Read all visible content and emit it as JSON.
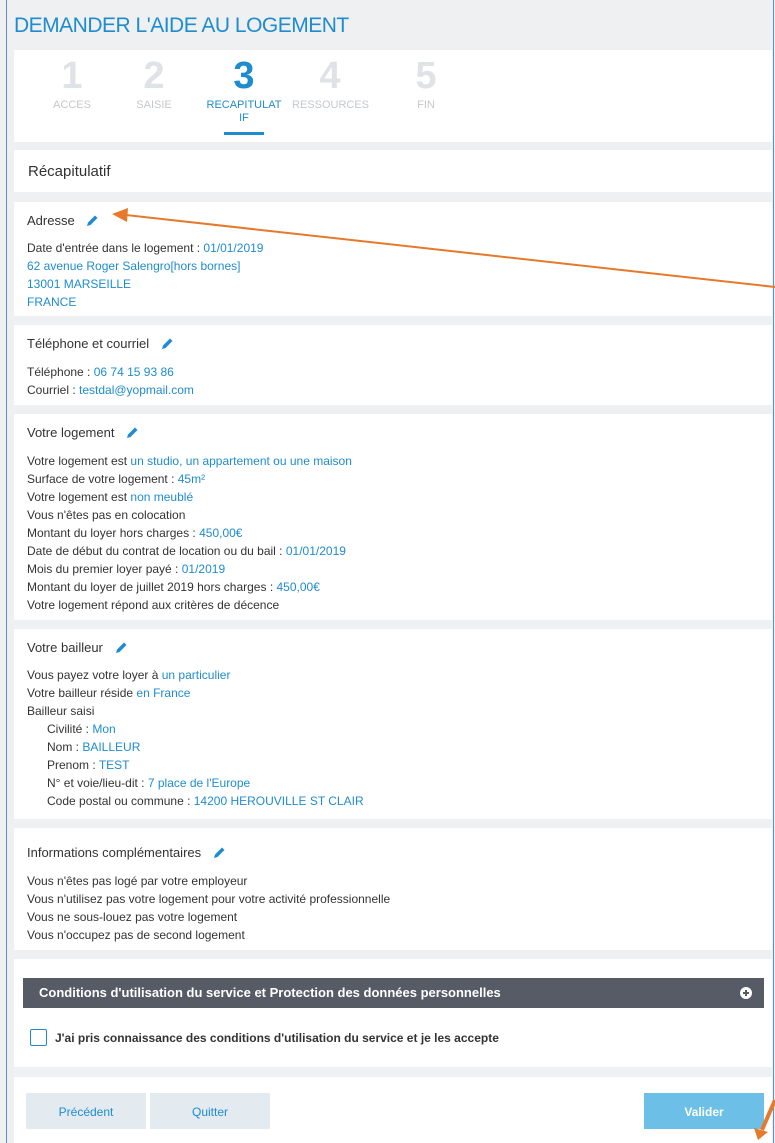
{
  "page": {
    "title": "DEMANDER L'AIDE AU LOGEMENT"
  },
  "stepper": {
    "steps": [
      {
        "num": "1",
        "label": "ACCES"
      },
      {
        "num": "2",
        "label": "SAISIE"
      },
      {
        "num": "3",
        "label": "RECAPITULATIF"
      },
      {
        "num": "4",
        "label": "RESSOURCES"
      },
      {
        "num": "5",
        "label": "FIN"
      }
    ],
    "active_index": 2
  },
  "recap": {
    "title": "Récapitulatif"
  },
  "address": {
    "title": "Adresse",
    "entry_label": "Date d'entrée dans le logement : ",
    "entry_value": "01/01/2019",
    "street": "62 avenue Roger Salengro[hors bornes]",
    "city": "13001 MARSEILLE",
    "country": "FRANCE"
  },
  "contact": {
    "title": "Téléphone et courriel",
    "phone_label": "Téléphone : ",
    "phone_value": "06 74 15 93 86",
    "email_label": "Courriel : ",
    "email_value": "testdal@yopmail.com"
  },
  "housing": {
    "title": "Votre logement",
    "type_label": "Votre logement est ",
    "type_value": "un studio, un appartement ou une maison",
    "surface_label": "Surface de votre logement : ",
    "surface_value": "45m²",
    "furnished_label": "Votre logement est ",
    "furnished_value": "non meublé",
    "coloc_text": "Vous n'êtes pas en colocation",
    "rent_label": "Montant du loyer hors charges : ",
    "rent_value": "450,00€",
    "lease_label": "Date de début du contrat de location ou du bail : ",
    "lease_value": "01/01/2019",
    "first_rent_label": "Mois du premier loyer payé : ",
    "first_rent_value": "01/2019",
    "july_label": "Montant du loyer de juillet 2019 hors charges : ",
    "july_value": "450,00€",
    "decency_text": "Votre logement répond aux critères de décence"
  },
  "landlord": {
    "title": "Votre bailleur",
    "pay_label": "Vous payez votre loyer à ",
    "pay_value": "un particulier",
    "resides_label": "Votre bailleur réside ",
    "resides_value": "en France",
    "entered_text": "Bailleur saisi",
    "civility_label": "Civilité : ",
    "civility_value": "Mon",
    "name_label": "Nom : ",
    "name_value": "BAILLEUR",
    "firstname_label": "Prenom : ",
    "firstname_value": "TEST",
    "street_label": "N° et voie/lieu-dit  : ",
    "street_value": "7 place de l'Europe",
    "postal_label": "Code postal ou commune  : ",
    "postal_value": "14200 HEROUVILLE ST CLAIR"
  },
  "extra": {
    "title": "Informations complémentaires",
    "line1": "Vous n'êtes pas logé par votre employeur",
    "line2": "Vous n'utilisez pas votre logement pour votre activité professionnelle",
    "line3": "Vous ne sous-louez pas votre logement",
    "line4": "Vous n'occupez pas de second logement"
  },
  "conditions": {
    "title": "Conditions d'utilisation du service et Protection des données personnelles",
    "accept_label": "J'ai pris connaissance des conditions d'utilisation du service et je les accepte",
    "expand_icon": "plus-circle-icon"
  },
  "footer": {
    "previous_label": "Précédent",
    "quit_label": "Quitter",
    "submit_label": "Valider"
  },
  "colors": {
    "accent": "#1f8ccf",
    "annotation_arrow": "#e6792b",
    "dark_bar": "#565b66",
    "primary_button": "#6cbfe6"
  }
}
